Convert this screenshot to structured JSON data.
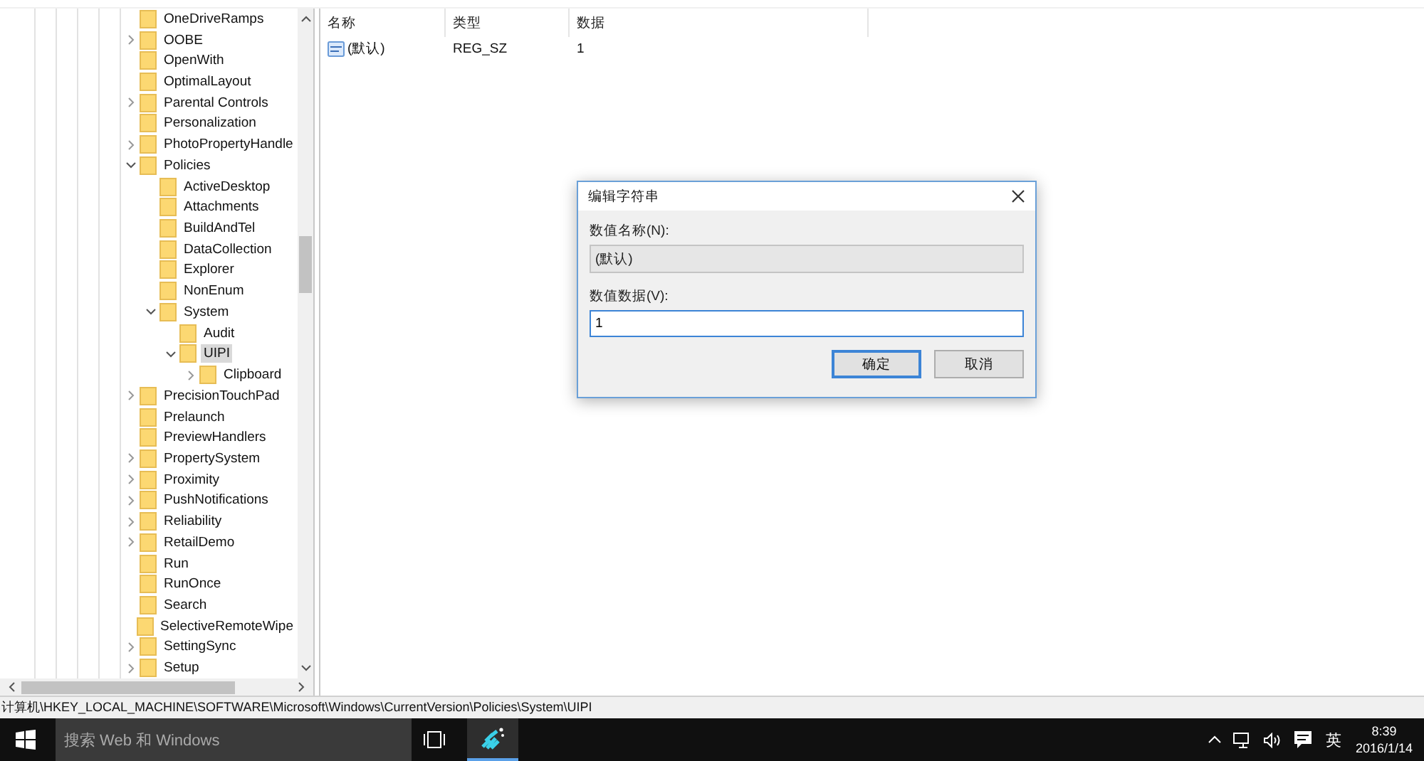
{
  "tree": [
    {
      "label": "OneDriveRamps",
      "selected": false
    },
    {
      "label": "OOBE",
      "expanded": false,
      "selected": false
    },
    {
      "label": "OpenWith",
      "selected": false
    },
    {
      "label": "OptimalLayout",
      "selected": false
    },
    {
      "label": "Parental Controls",
      "expanded": false,
      "selected": false
    },
    {
      "label": "Personalization",
      "selected": false
    },
    {
      "label": "PhotoPropertyHandle",
      "expanded": false,
      "selected": false
    },
    {
      "label": "Policies",
      "expanded": true,
      "selected": false,
      "children": [
        {
          "label": "ActiveDesktop",
          "selected": false
        },
        {
          "label": "Attachments",
          "selected": false
        },
        {
          "label": "BuildAndTel",
          "selected": false
        },
        {
          "label": "DataCollection",
          "selected": false
        },
        {
          "label": "Explorer",
          "selected": false
        },
        {
          "label": "NonEnum",
          "selected": false
        },
        {
          "label": "System",
          "expanded": true,
          "selected": false,
          "children": [
            {
              "label": "Audit",
              "selected": false
            },
            {
              "label": "UIPI",
              "expanded": true,
              "selected": true,
              "children": [
                {
                  "label": "Clipboard",
                  "expanded": false,
                  "selected": false
                }
              ]
            }
          ]
        }
      ]
    },
    {
      "label": "PrecisionTouchPad",
      "expanded": false,
      "selected": false
    },
    {
      "label": "Prelaunch",
      "selected": false
    },
    {
      "label": "PreviewHandlers",
      "selected": false
    },
    {
      "label": "PropertySystem",
      "expanded": false,
      "selected": false
    },
    {
      "label": "Proximity",
      "expanded": false,
      "selected": false
    },
    {
      "label": "PushNotifications",
      "expanded": false,
      "selected": false
    },
    {
      "label": "Reliability",
      "expanded": false,
      "selected": false
    },
    {
      "label": "RetailDemo",
      "expanded": false,
      "selected": false
    },
    {
      "label": "Run",
      "selected": false
    },
    {
      "label": "RunOnce",
      "selected": false
    },
    {
      "label": "Search",
      "selected": false
    },
    {
      "label": "SelectiveRemoteWipe",
      "selected": false
    },
    {
      "label": "SettingSync",
      "expanded": false,
      "selected": false
    },
    {
      "label": "Setup",
      "expanded": false,
      "selected": false
    }
  ],
  "values_table": {
    "columns": [
      "名称",
      "类型",
      "数据"
    ],
    "rows": [
      {
        "name": "(默认)",
        "type": "REG_SZ",
        "data": "1"
      }
    ]
  },
  "dialog": {
    "title": "编辑字符串",
    "name_label": "数值名称(N):",
    "name_value": "(默认)",
    "data_label": "数值数据(V):",
    "data_value": "1",
    "buttons": [
      {
        "label": "确定",
        "default": true
      },
      {
        "label": "取消",
        "default": false
      }
    ]
  },
  "status_bar": "计算机\\HKEY_LOCAL_MACHINE\\SOFTWARE\\Microsoft\\Windows\\CurrentVersion\\Policies\\System\\UIPI",
  "taskbar": {
    "search_placeholder": "搜索 Web 和 Windows",
    "ime": "英",
    "time": "8:39",
    "date": "2016/1/14"
  }
}
